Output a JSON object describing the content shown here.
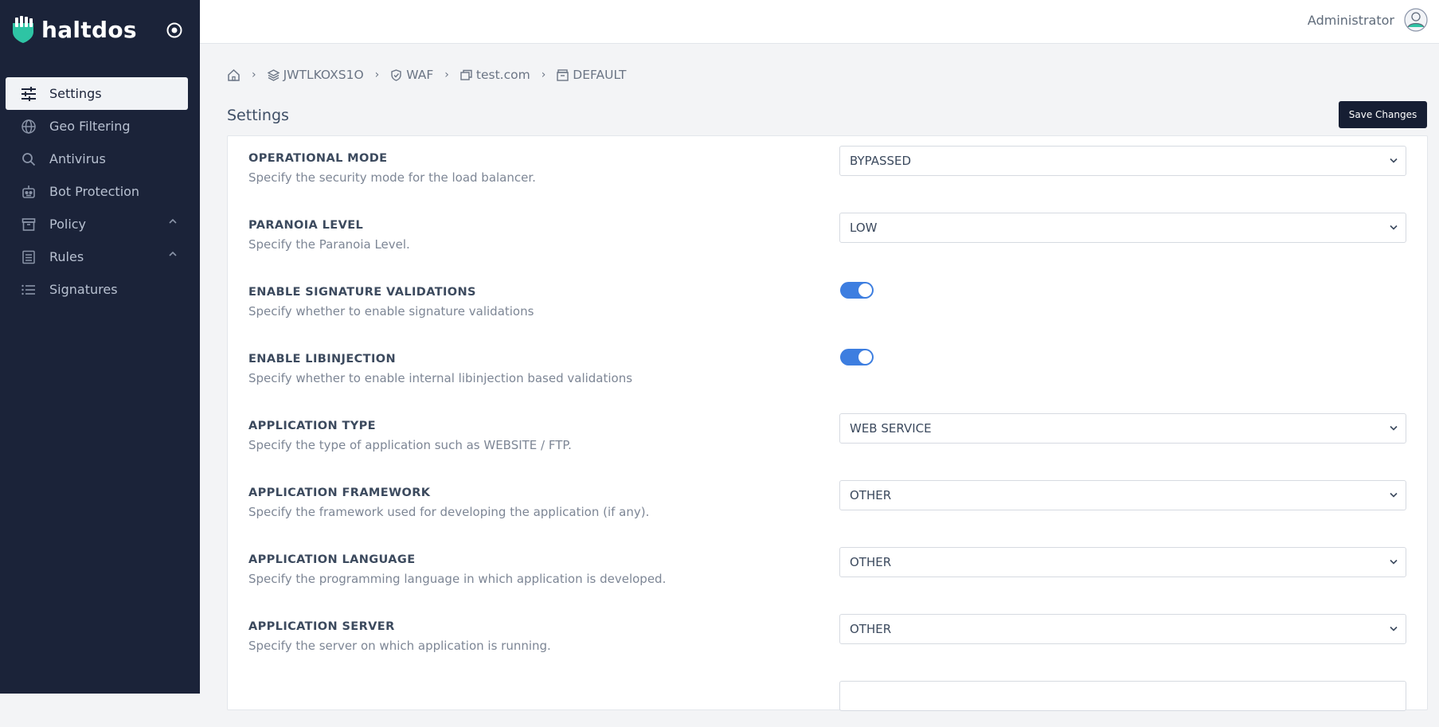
{
  "brand": {
    "name": "haltdos"
  },
  "sidebar": {
    "items": [
      {
        "label": "Settings",
        "icon": "sliders-icon",
        "active": true
      },
      {
        "label": "Geo Filtering",
        "icon": "globe-icon"
      },
      {
        "label": "Antivirus",
        "icon": "search-icon"
      },
      {
        "label": "Bot Protection",
        "icon": "robot-icon"
      },
      {
        "label": "Policy",
        "icon": "archive-icon",
        "expandable": true
      },
      {
        "label": "Rules",
        "icon": "list-box-icon",
        "expandable": true
      },
      {
        "label": "Signatures",
        "icon": "list-icon"
      }
    ]
  },
  "header": {
    "user": "Administrator"
  },
  "breadcrumb": [
    "JWTLKOXS1O",
    "WAF",
    "test.com",
    "DEFAULT"
  ],
  "page": {
    "title": "Settings",
    "save_label": "Save Changes"
  },
  "settings": [
    {
      "title": "OPERATIONAL MODE",
      "desc": "Specify the security mode for the load balancer.",
      "value": "BYPASSED"
    },
    {
      "title": "PARANOIA LEVEL",
      "desc": "Specify the Paranoia Level.",
      "value": "LOW"
    },
    {
      "title": "ENABLE SIGNATURE VALIDATIONS",
      "desc": "Specify whether to enable signature validations",
      "toggle": true
    },
    {
      "title": "ENABLE LIBINJECTION",
      "desc": "Specify whether to enable internal libinjection based validations",
      "toggle": true
    },
    {
      "title": "APPLICATION TYPE",
      "desc": "Specify the type of application such as WEBSITE / FTP.",
      "value": "WEB SERVICE"
    },
    {
      "title": "APPLICATION FRAMEWORK",
      "desc": "Specify the framework used for developing the application (if any).",
      "value": "OTHER"
    },
    {
      "title": "APPLICATION LANGUAGE",
      "desc": "Specify the programming language in which application is developed.",
      "value": "OTHER"
    },
    {
      "title": "APPLICATION SERVER",
      "desc": "Specify the server on which application is running.",
      "value": "OTHER"
    }
  ],
  "colors": {
    "sidebar": "#1b2339",
    "accent": "#3d7ee0",
    "brand_icon": "#2ec4a4",
    "button": "#161e33"
  }
}
